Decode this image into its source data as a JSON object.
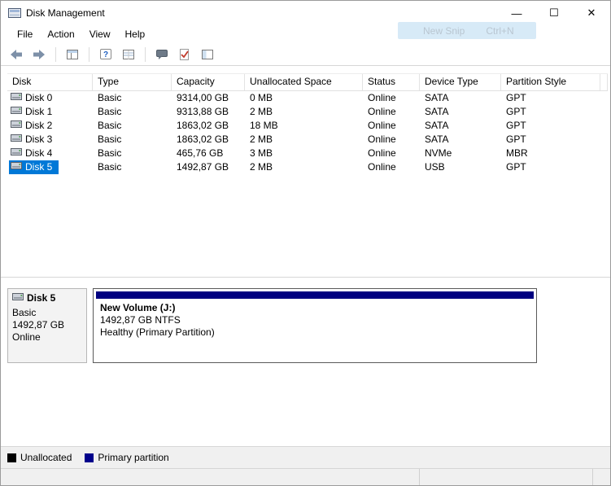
{
  "window": {
    "title": "Disk Management",
    "controls": {
      "minimize": "—",
      "maximize": "☐",
      "close": "✕"
    }
  },
  "snip_overlay": {
    "label": "New Snip",
    "shortcut": "Ctrl+N"
  },
  "menu": {
    "items": [
      "File",
      "Action",
      "View",
      "Help"
    ]
  },
  "toolbar": {
    "icons": [
      "back-arrow-icon",
      "forward-arrow-icon",
      "console-tree-icon",
      "help-icon",
      "export-list-icon",
      "speech-bubble-icon",
      "action-check-icon",
      "panes-icon"
    ]
  },
  "table": {
    "columns": [
      "Disk",
      "Type",
      "Capacity",
      "Unallocated Space",
      "Status",
      "Device Type",
      "Partition Style"
    ],
    "rows": [
      {
        "disk": "Disk 0",
        "type": "Basic",
        "capacity": "9314,00 GB",
        "unallocated": "0 MB",
        "status": "Online",
        "device": "SATA",
        "partition": "GPT"
      },
      {
        "disk": "Disk 1",
        "type": "Basic",
        "capacity": "9313,88 GB",
        "unallocated": "2 MB",
        "status": "Online",
        "device": "SATA",
        "partition": "GPT"
      },
      {
        "disk": "Disk 2",
        "type": "Basic",
        "capacity": "1863,02 GB",
        "unallocated": "18 MB",
        "status": "Online",
        "device": "SATA",
        "partition": "GPT"
      },
      {
        "disk": "Disk 3",
        "type": "Basic",
        "capacity": "1863,02 GB",
        "unallocated": "2 MB",
        "status": "Online",
        "device": "SATA",
        "partition": "GPT"
      },
      {
        "disk": "Disk 4",
        "type": "Basic",
        "capacity": "465,76 GB",
        "unallocated": "3 MB",
        "status": "Online",
        "device": "NVMe",
        "partition": "MBR"
      },
      {
        "disk": "Disk 5",
        "type": "Basic",
        "capacity": "1492,87 GB",
        "unallocated": "2 MB",
        "status": "Online",
        "device": "USB",
        "partition": "GPT"
      }
    ],
    "selected_row": "Disk 5"
  },
  "graphical_view": {
    "disk_panel": {
      "name": "Disk 5",
      "type": "Basic",
      "capacity": "1492,87 GB",
      "status": "Online"
    },
    "volume": {
      "name": "New Volume  (J:)",
      "size_fs": "1492,87 GB NTFS",
      "health": "Healthy (Primary Partition)"
    }
  },
  "legend": {
    "items": [
      {
        "label": "Unallocated",
        "color": "#000000"
      },
      {
        "label": "Primary partition",
        "color": "#00008b"
      }
    ]
  },
  "colors": {
    "selection": "#0078d7",
    "volume_bar": "#000080"
  }
}
